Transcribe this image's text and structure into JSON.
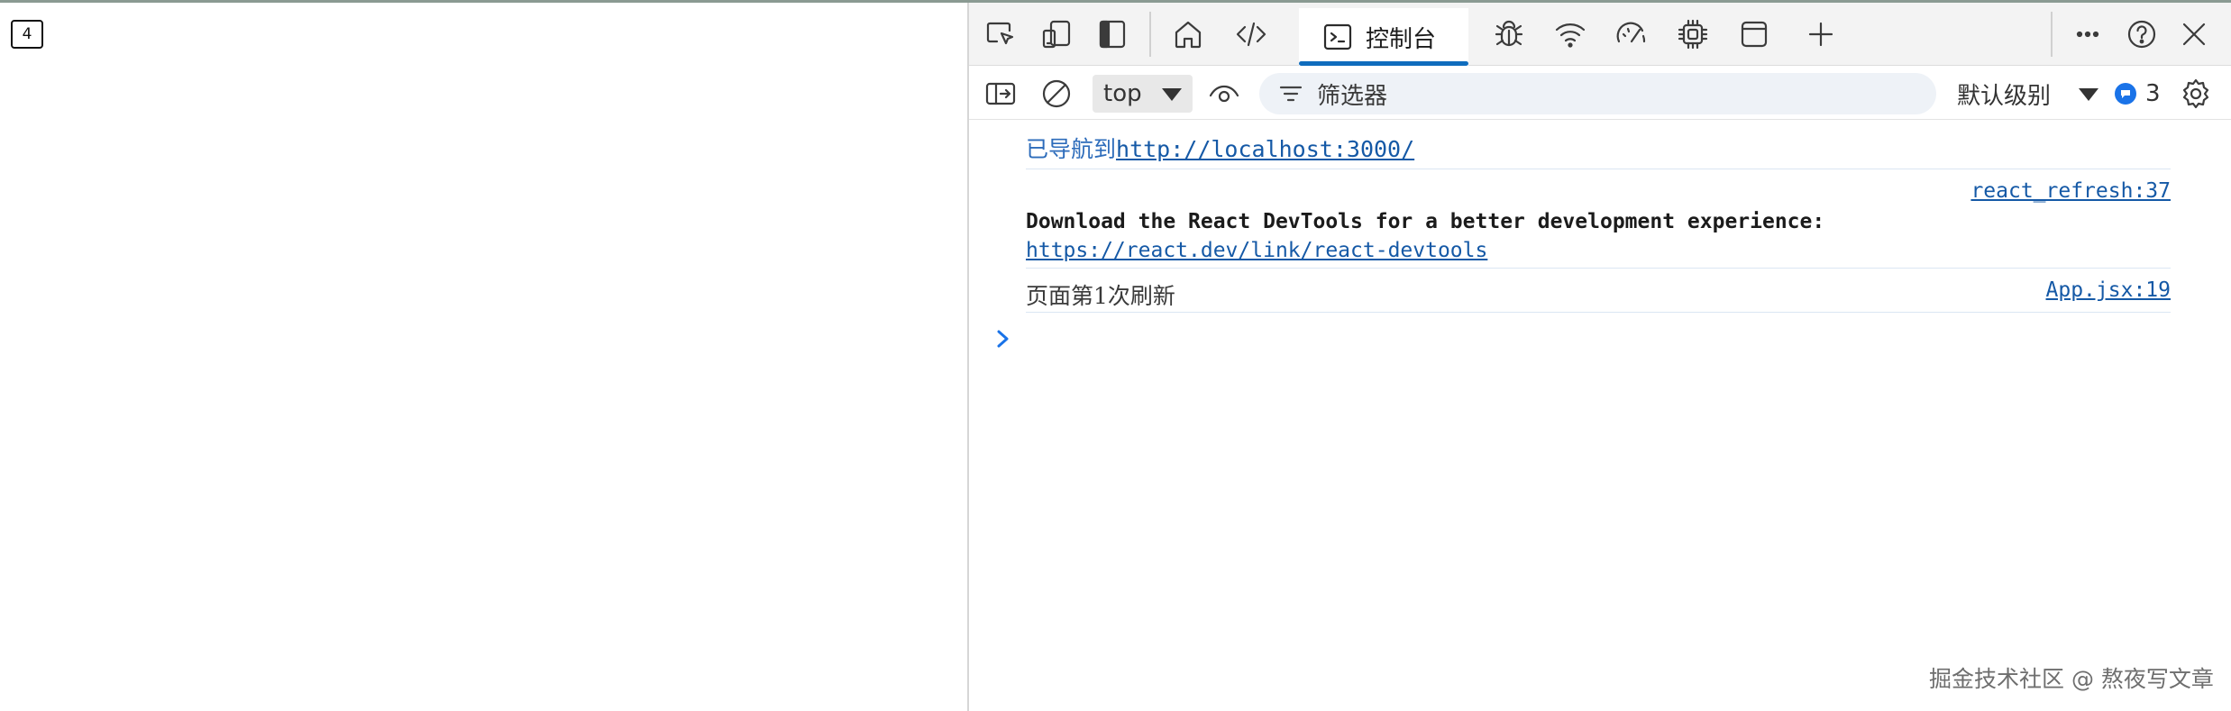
{
  "page": {
    "counter_value": "4"
  },
  "devtools": {
    "tabs": {
      "console_label": "控制台"
    },
    "toolbar": {
      "context_value": "top",
      "filter_placeholder": "筛选器",
      "level_value": "默认级别",
      "issues_count": "3"
    },
    "messages": {
      "navigation_prefix": "已导航到",
      "navigation_url": "http://localhost:3000/",
      "react_source": "react_refresh:37",
      "react_text": "Download the React DevTools for a better development experience:",
      "react_link": "https://react.dev/link/react-devtools",
      "log_text": "页面第1次刷新",
      "log_source": "App.jsx:19"
    }
  },
  "watermark": "掘金技术社区 @ 熬夜写文章",
  "colors": {
    "accent": "#0f6cbd",
    "link": "#1559a6",
    "navigation_text": "#2d6cbb",
    "issues_badge": "#1a73e8"
  }
}
